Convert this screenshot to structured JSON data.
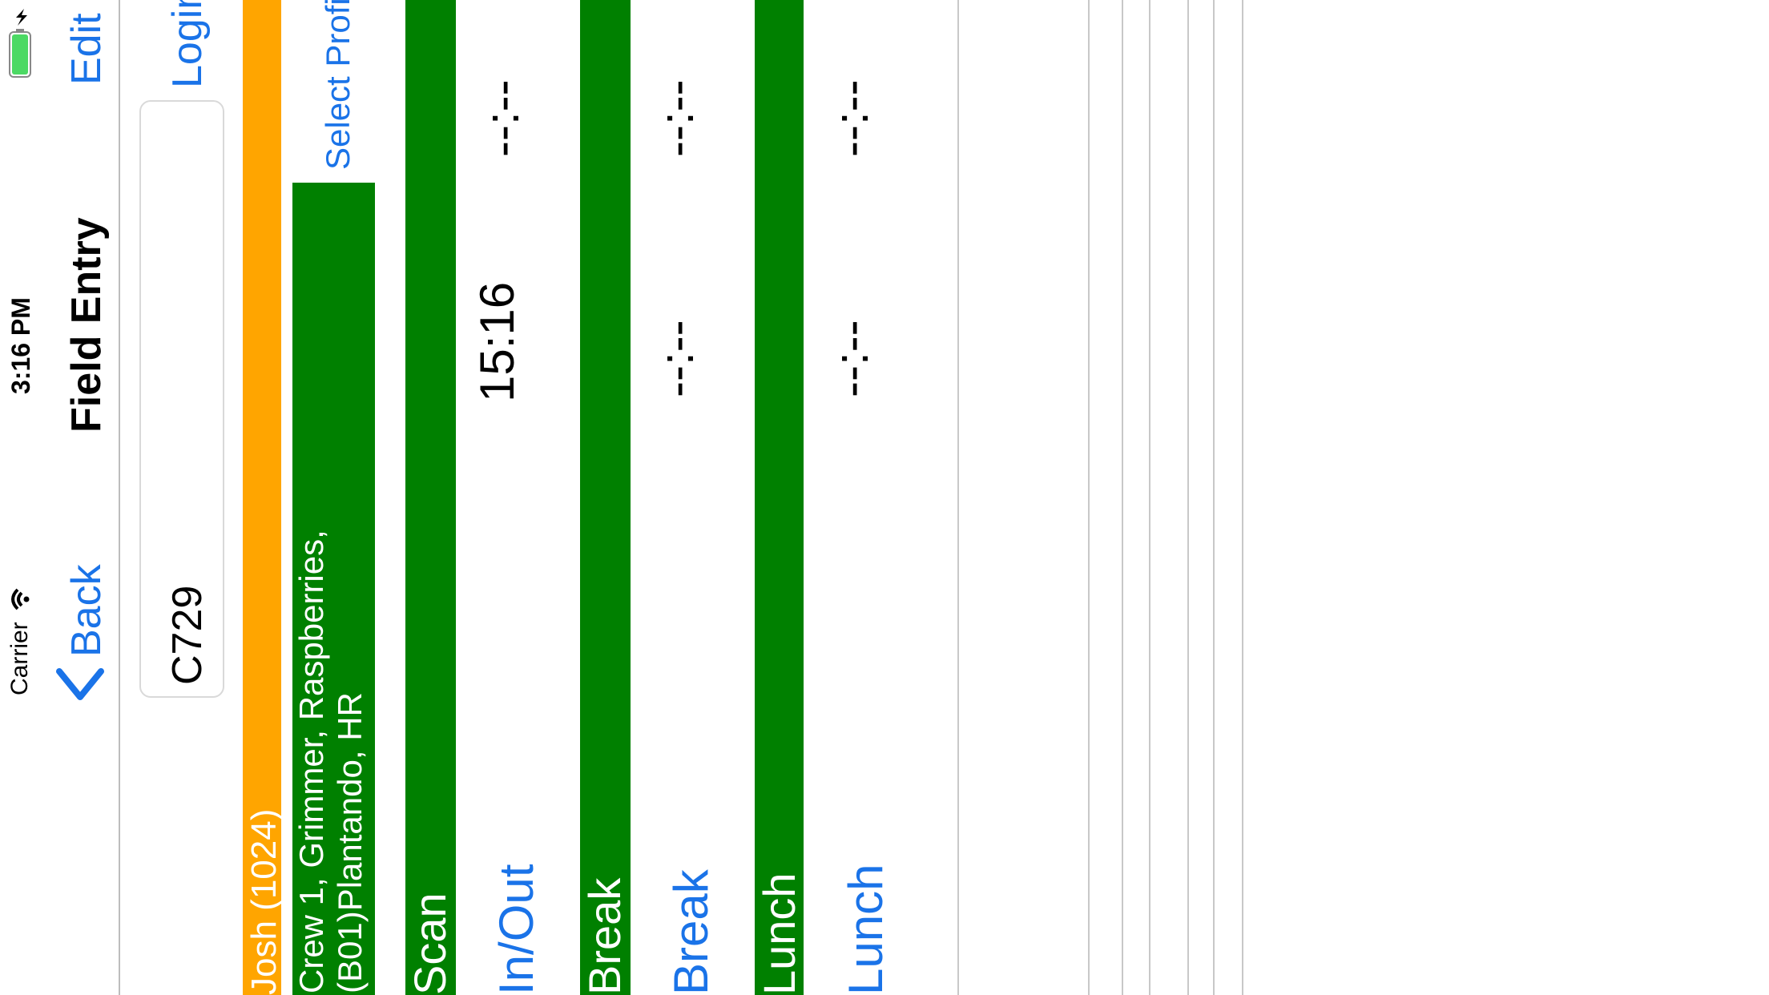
{
  "status_bar": {
    "carrier": "Carrier",
    "time": "3:16 PM"
  },
  "nav": {
    "back_label": "Back",
    "title": "Field Entry",
    "edit_label": "Edit"
  },
  "login": {
    "code_value": "C729",
    "login_label": "Login"
  },
  "worker": {
    "name": "Josh (1024)"
  },
  "crew": {
    "line1": "Crew 1, Grimmer, Raspberries,",
    "line2": "(B01)Plantando, HR",
    "select_profile_label": "Select Profile"
  },
  "scan": {
    "header": "Scan",
    "inout_label": "In/Out",
    "time_in": "15:16",
    "time_out": "--:--"
  },
  "break": {
    "header": "Break",
    "button_label": "Break",
    "time_start": "--:--",
    "time_end": "--:--"
  },
  "lunch": {
    "header": "Lunch",
    "button_label": "Lunch",
    "time_start": "--:--",
    "time_end": "--:--"
  },
  "colors": {
    "accent": "#1a73e8",
    "green": "#008000",
    "orange": "#ffa500"
  }
}
